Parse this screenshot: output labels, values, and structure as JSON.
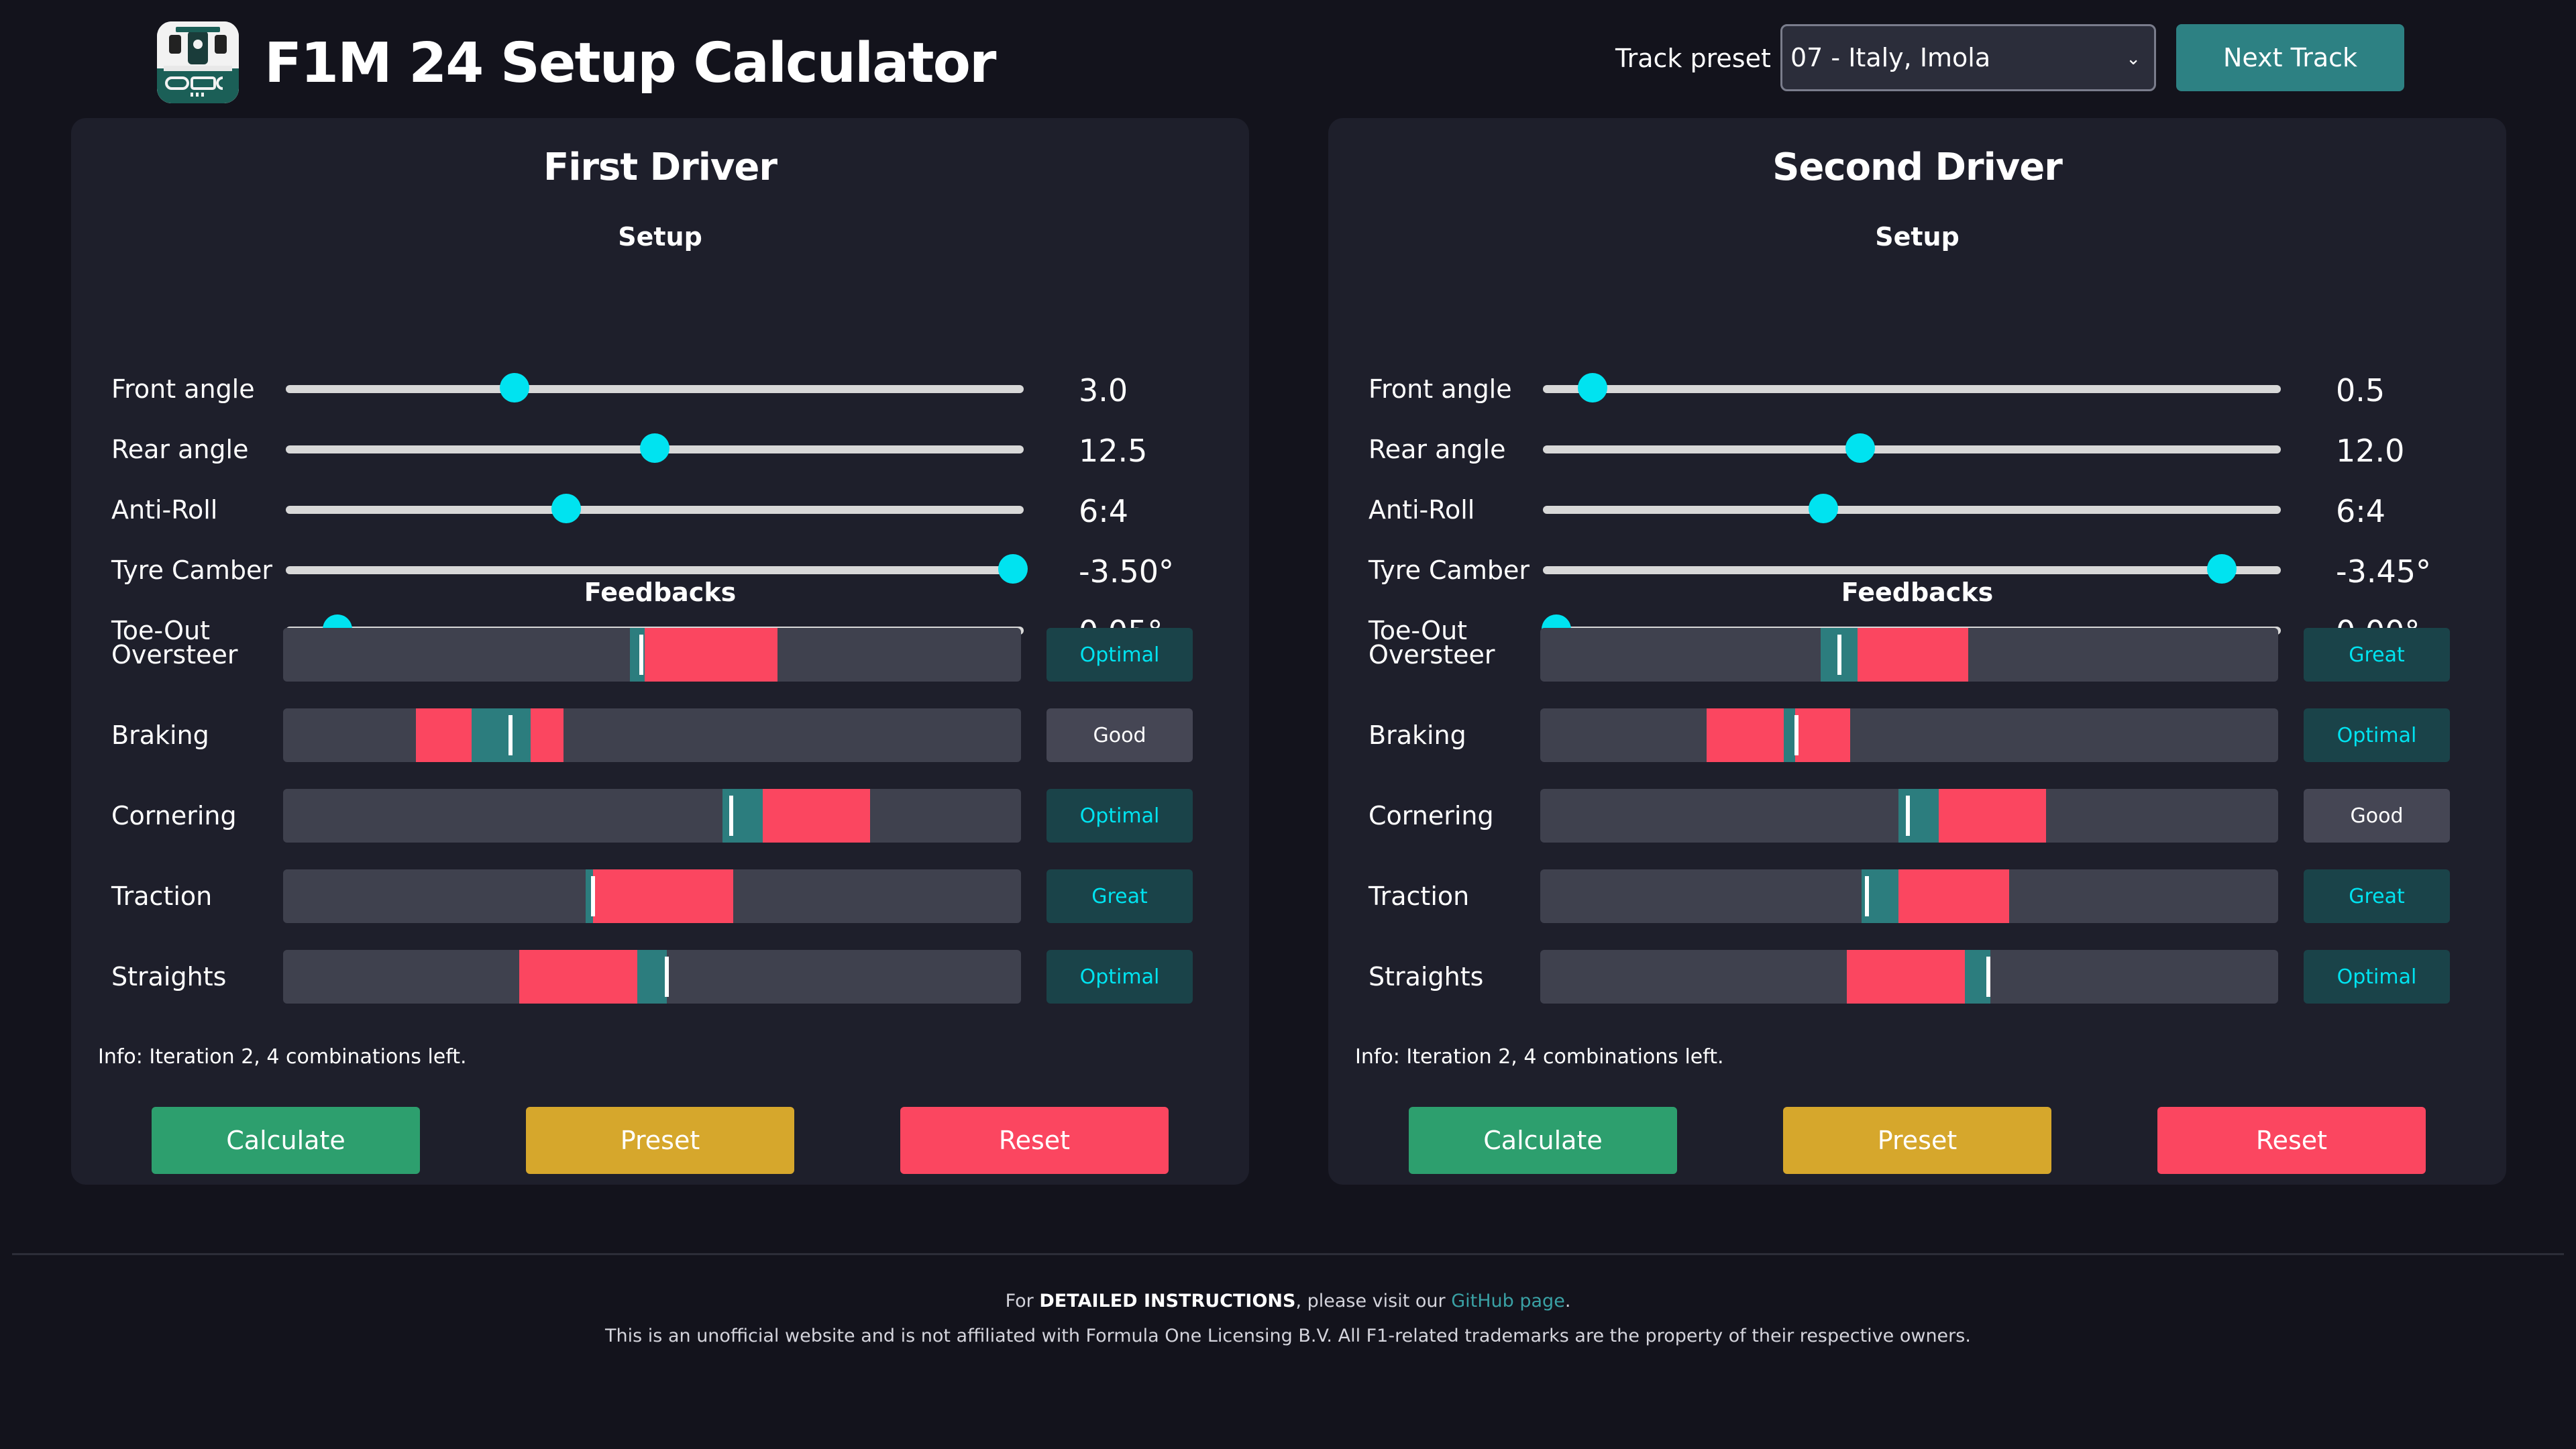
{
  "header": {
    "title": "F1M 24 Setup Calculator",
    "track_label": "Track preset",
    "track_value": "07 - Italy, Imola",
    "next_track_label": "Next Track"
  },
  "drivers": [
    {
      "title": "First Driver",
      "setup_title": "Setup",
      "feedback_title": "Feedbacks",
      "setup": [
        {
          "label": "Front angle",
          "value": "3.0",
          "position": 0.31
        },
        {
          "label": "Rear angle",
          "value": "12.5",
          "position": 0.5
        },
        {
          "label": "Anti-Roll",
          "value": "6:4",
          "position": 0.38
        },
        {
          "label": "Tyre Camber",
          "value": "-3.50°",
          "position": 0.985
        },
        {
          "label": "Toe-Out",
          "value": "0.05°",
          "position": 0.07
        }
      ],
      "feedback": [
        {
          "label": "Oversteer",
          "status": "Optimal",
          "style": "teal",
          "red": [
            0.49,
            0.67
          ],
          "teal": [
            0.47,
            0.49
          ],
          "marker": 0.485
        },
        {
          "label": "Braking",
          "status": "Good",
          "style": "gray",
          "red": [
            0.18,
            0.38
          ],
          "teal": [
            0.255,
            0.335
          ],
          "marker": 0.308
        },
        {
          "label": "Cornering",
          "status": "Optimal",
          "style": "teal",
          "red": [
            0.65,
            0.795
          ],
          "teal": [
            0.595,
            0.65
          ],
          "marker": 0.607
        },
        {
          "label": "Traction",
          "status": "Great",
          "style": "teal",
          "red": [
            0.42,
            0.61
          ],
          "teal": [
            0.41,
            0.42
          ],
          "marker": 0.42
        },
        {
          "label": "Straights",
          "status": "Optimal",
          "style": "teal",
          "red": [
            0.32,
            0.48
          ],
          "teal": [
            0.48,
            0.52
          ],
          "marker": 0.52
        }
      ],
      "info": "Info: Iteration 2, 4 combinations left.",
      "buttons": {
        "calculate": "Calculate",
        "preset": "Preset",
        "reset": "Reset"
      }
    },
    {
      "title": "Second Driver",
      "setup_title": "Setup",
      "feedback_title": "Feedbacks",
      "setup": [
        {
          "label": "Front angle",
          "value": "0.5",
          "position": 0.067
        },
        {
          "label": "Rear angle",
          "value": "12.0",
          "position": 0.43
        },
        {
          "label": "Anti-Roll",
          "value": "6:4",
          "position": 0.38
        },
        {
          "label": "Tyre Camber",
          "value": "-3.45°",
          "position": 0.92
        },
        {
          "label": "Toe-Out",
          "value": "0.00°",
          "position": 0.018
        }
      ],
      "feedback": [
        {
          "label": "Oversteer",
          "status": "Great",
          "style": "teal",
          "red": [
            0.43,
            0.58
          ],
          "teal": [
            0.38,
            0.43
          ],
          "marker": 0.405
        },
        {
          "label": "Braking",
          "status": "Optimal",
          "style": "teal",
          "red": [
            0.225,
            0.42
          ],
          "teal": [
            0.33,
            0.345
          ],
          "marker": 0.347
        },
        {
          "label": "Cornering",
          "status": "Good",
          "style": "gray",
          "red": [
            0.54,
            0.685
          ],
          "teal": [
            0.485,
            0.54
          ],
          "marker": 0.498
        },
        {
          "label": "Traction",
          "status": "Great",
          "style": "teal",
          "red": [
            0.485,
            0.635
          ],
          "teal": [
            0.435,
            0.485
          ],
          "marker": 0.443
        },
        {
          "label": "Straights",
          "status": "Optimal",
          "style": "teal",
          "red": [
            0.415,
            0.575
          ],
          "teal": [
            0.575,
            0.61
          ],
          "marker": 0.607
        }
      ],
      "info": "Info: Iteration 2, 4 combinations left.",
      "buttons": {
        "calculate": "Calculate",
        "preset": "Preset",
        "reset": "Reset"
      }
    }
  ],
  "footer": {
    "line1_prefix": "For ",
    "line1_bold": "DETAILED INSTRUCTIONS",
    "line1_mid": ", please visit our ",
    "line1_link": "GitHub page",
    "line1_suffix": ".",
    "line2": "This is an unofficial website and is not affiliated with Formula One Licensing B.V. All F1-related trademarks are the property of their respective owners."
  },
  "colors": {
    "accent": "#00e3f0",
    "bar_red": "#fb4660",
    "bar_teal": "#2c7d7e",
    "calculate": "#2d9f6e",
    "preset": "#d6a72c",
    "reset": "#fb4660"
  },
  "icons": {
    "logo": "f1-car-logo-icon",
    "select_chevron": "chevron-down-icon"
  }
}
